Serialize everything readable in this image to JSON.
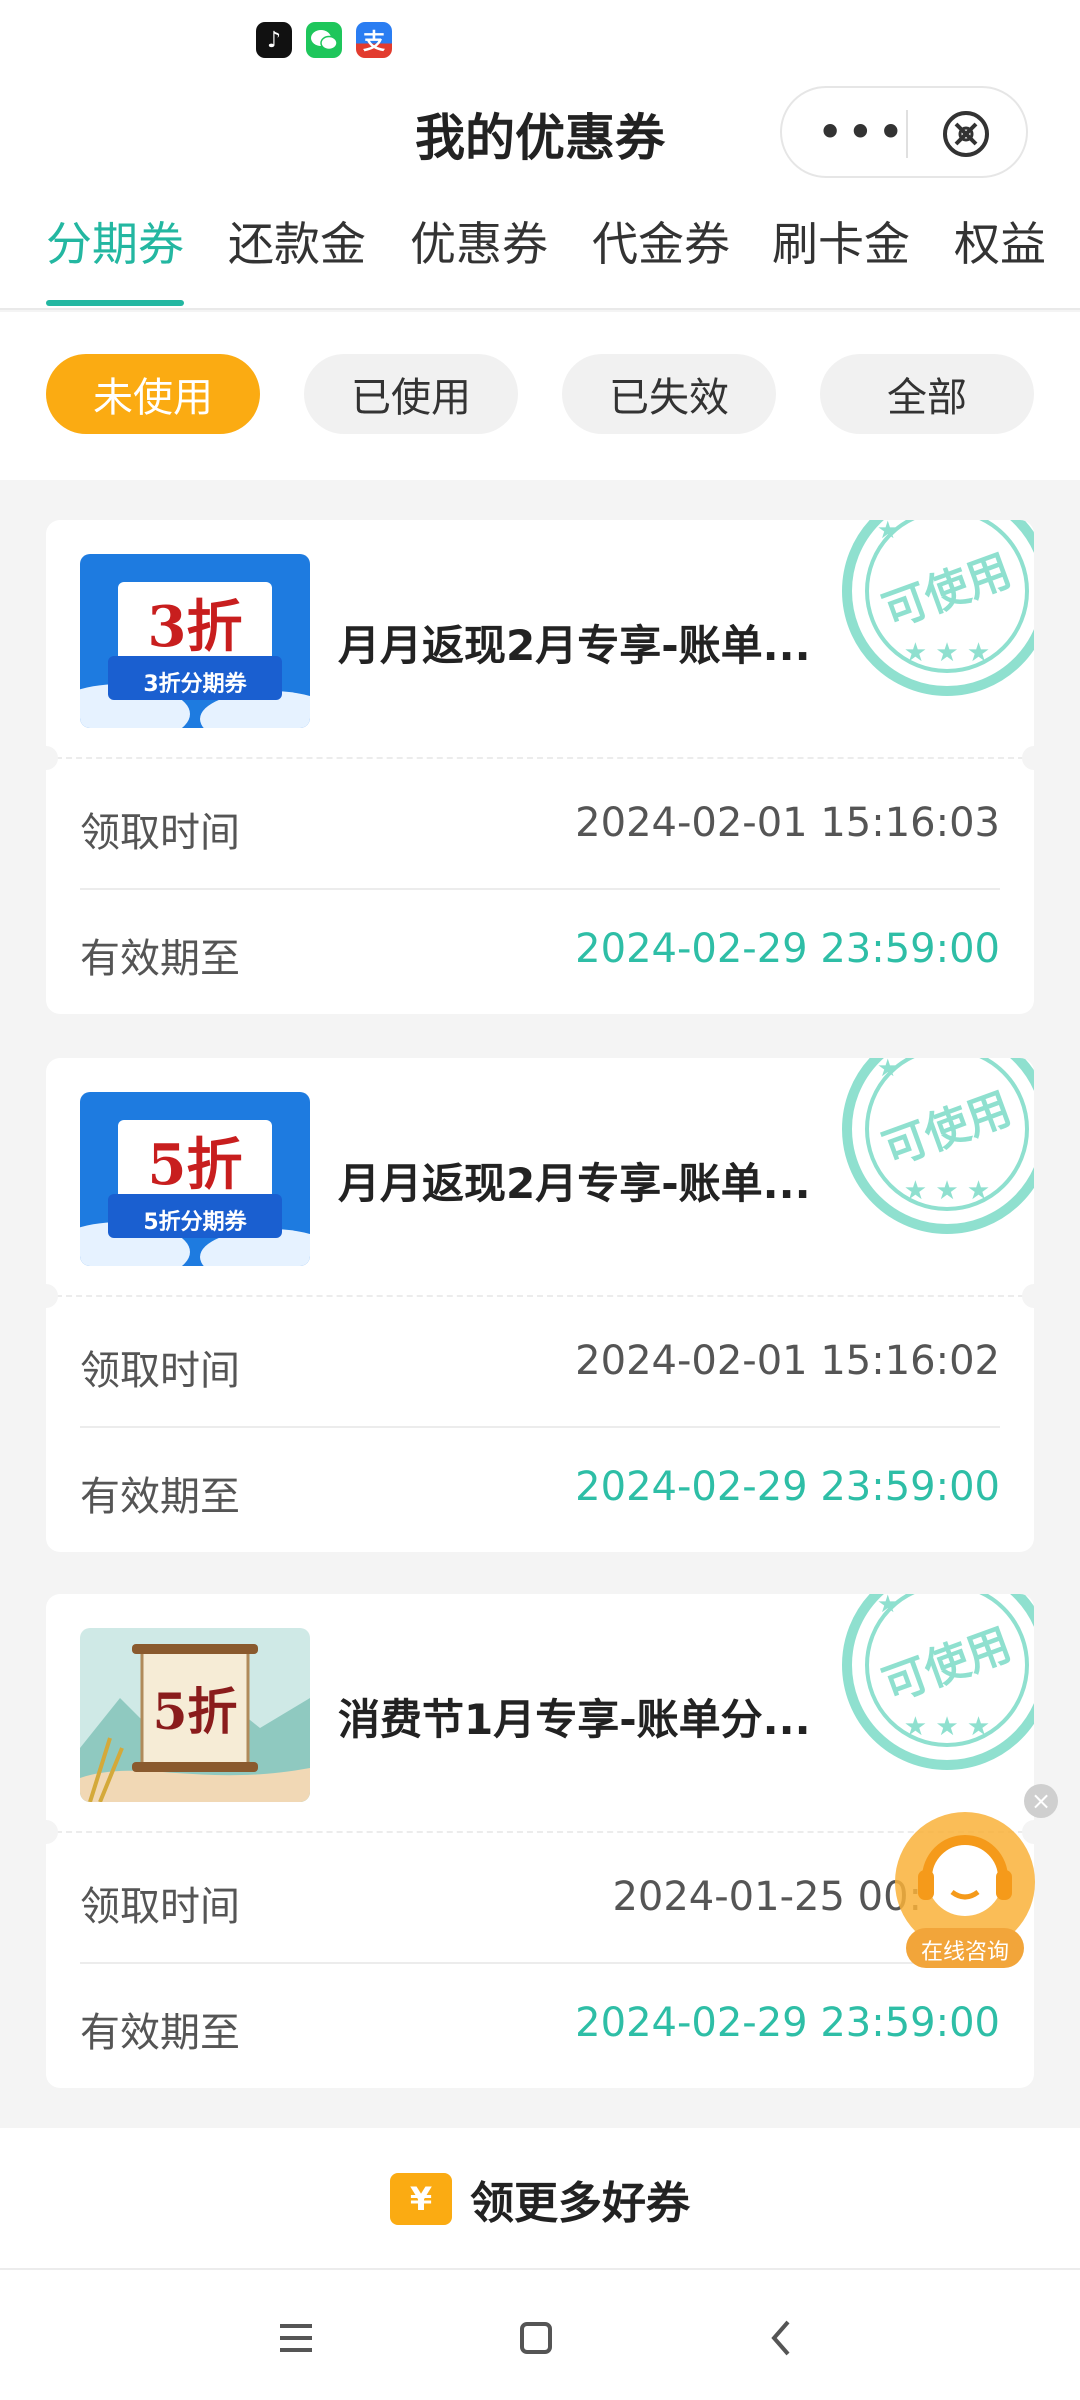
{
  "header": {
    "title": "我的优惠券",
    "more_icon": "more-dots-icon",
    "close_icon": "close-mini-program-icon"
  },
  "tabs": [
    {
      "label": "分期券",
      "active": true
    },
    {
      "label": "还款金",
      "active": false
    },
    {
      "label": "优惠券",
      "active": false
    },
    {
      "label": "代金券",
      "active": false
    },
    {
      "label": "刷卡金",
      "active": false
    },
    {
      "label": "权益",
      "active": false
    }
  ],
  "filters": [
    {
      "label": "未使用",
      "active": true
    },
    {
      "label": "已使用",
      "active": false
    },
    {
      "label": "已失效",
      "active": false
    },
    {
      "label": "全部",
      "active": false
    }
  ],
  "coupons": [
    {
      "thumb_text": "3折",
      "thumb_caption": "3折分期券",
      "name": "月月返现2月专享-账单...",
      "stamp": "可使用",
      "received_label": "领取时间",
      "received_value": "2024-02-01 15:16:03",
      "valid_label": "有效期至",
      "valid_value": "2024-02-29 23:59:00"
    },
    {
      "thumb_text": "5折",
      "thumb_caption": "5折分期券",
      "name": "月月返现2月专享-账单...",
      "stamp": "可使用",
      "received_label": "领取时间",
      "received_value": "2024-02-01 15:16:02",
      "valid_label": "有效期至",
      "valid_value": "2024-02-29 23:59:00"
    },
    {
      "thumb_text": "5折",
      "name": "消费节1月专享-账单分...",
      "stamp": "可使用",
      "received_label": "领取时间",
      "received_value": "2024-01-25 00:",
      "valid_label": "有效期至",
      "valid_value": "2024-02-29 23:59:00"
    }
  ],
  "float_service": {
    "label": "在线咨询"
  },
  "more_coupons": {
    "icon": "¥",
    "label": "领更多好券"
  },
  "colors": {
    "accent": "#23b7a1",
    "orange": "#fbab12",
    "valid_green": "#2ebea6"
  }
}
